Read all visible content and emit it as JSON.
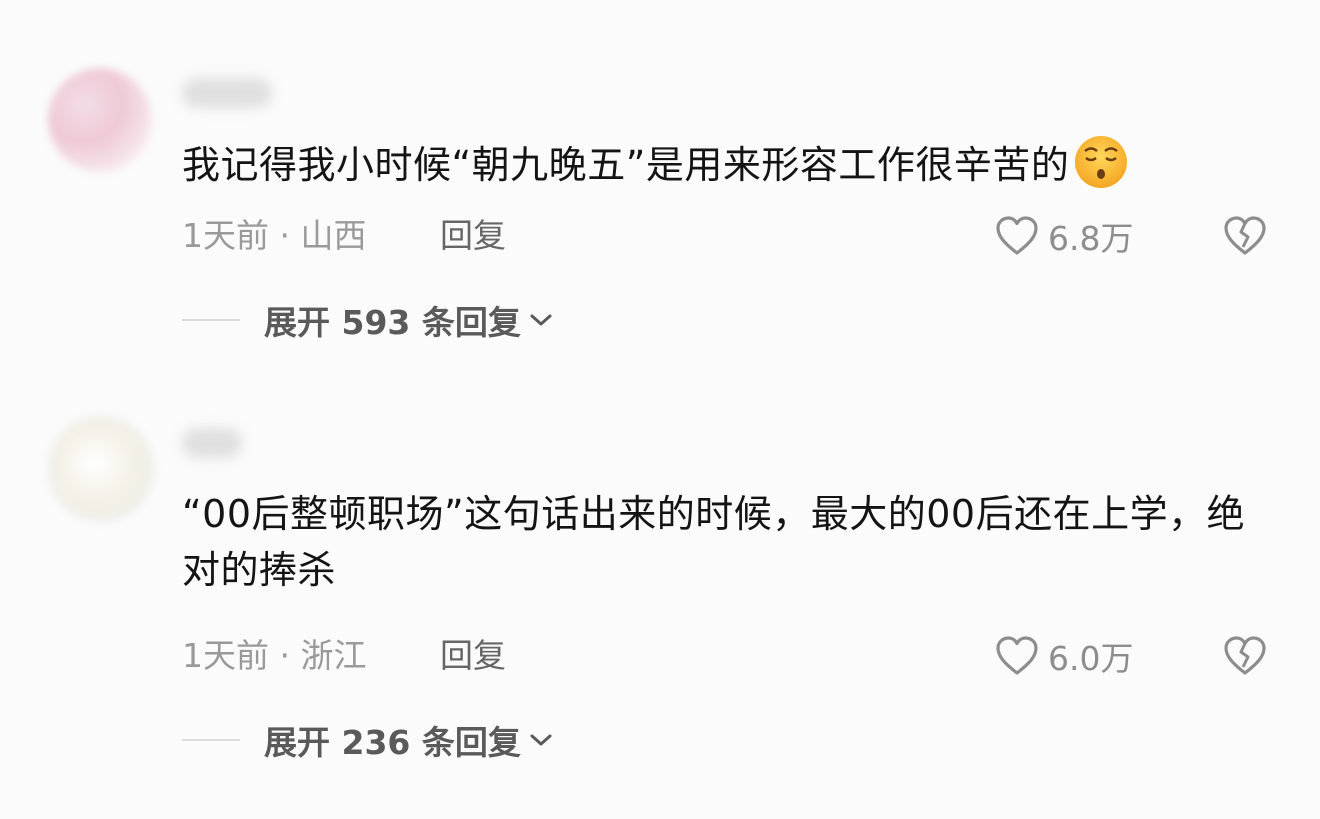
{
  "comments": [
    {
      "text": "我记得我小时候“朝九晚五”是用来形容工作很辛苦的",
      "emoji": "yawning-face-emoji",
      "time_location": "1天前 · 山西",
      "reply_label": "回复",
      "likes": "6.8万",
      "expand_label": "展开 593 条回复"
    },
    {
      "text": "“00后整顿职场”这句话出来的时候，最大的00后还在上学，绝对的捧杀",
      "time_location": "1天前 · 浙江",
      "reply_label": "回复",
      "likes": "6.0万",
      "expand_label": "展开 236 条回复"
    }
  ],
  "icons": {
    "like": "heart-outline-icon",
    "dislike": "broken-heart-icon",
    "expand": "chevron-down-icon"
  },
  "colors": {
    "background": "#fbfbfb",
    "text": "#141414",
    "meta": "#9a9a9a"
  }
}
